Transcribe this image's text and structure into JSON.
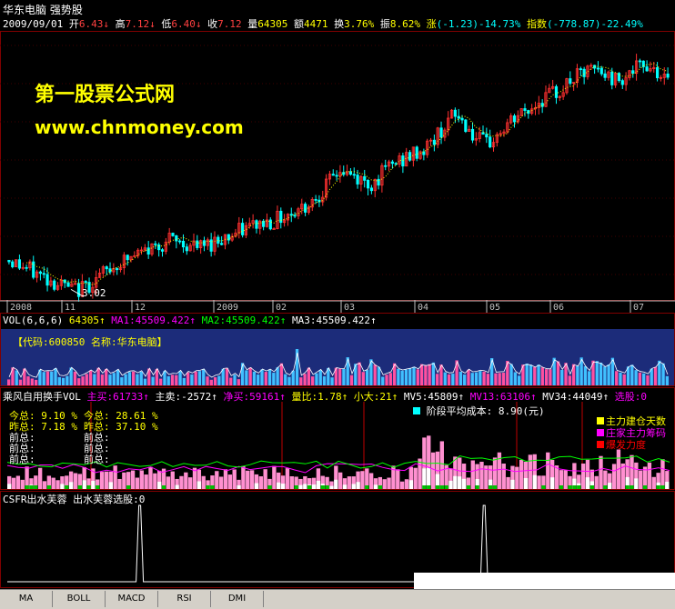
{
  "header": {
    "title": "华东电脑  强势股",
    "date": "2009/09/01",
    "open_label": "开",
    "open": "6.43",
    "high_label": "高",
    "high": "7.12",
    "low_label": "低",
    "low": "6.40",
    "close_label": "收",
    "close": "7.12",
    "vol_label": "量",
    "vol": "64305",
    "amount_label": "额",
    "amount": "4471",
    "turnover_label": "换",
    "turnover": "3.76%",
    "amplitude_label": "振",
    "amplitude": "8.62%",
    "change_label": "涨",
    "change": "(-1.23)-14.73%",
    "index_label": "指数",
    "index": "(-778.87)-22.49%",
    "arrow": "↓"
  },
  "watermark": {
    "line1": "第一股票公式网",
    "line2": "www.chnmoney.com"
  },
  "colors": {
    "up": "#ff3030",
    "down": "#00ffff",
    "ma_yellow": "#ffff00",
    "panel_border": "#800000",
    "vol_bg": "#1c2c7a",
    "vol_up_fill": "#ff50a0",
    "vol_down_fill": "#40c0ff"
  },
  "chart_data": [
    {
      "type": "candlestick",
      "x_axis_labels": [
        "2008",
        "11",
        "12",
        "2009",
        "02",
        "03",
        "04",
        "05",
        "06",
        "07"
      ],
      "annotation_low": "3.02",
      "note": "Price trend rises from about 3.0 to 7.5 over the period",
      "trend": [
        3.6,
        3.5,
        3.4,
        3.3,
        3.2,
        3.1,
        3.0,
        3.05,
        3.2,
        3.35,
        3.5,
        3.6,
        3.7,
        3.8,
        3.9,
        4.0,
        3.95,
        3.9,
        3.85,
        3.95,
        4.05,
        4.1,
        4.2,
        4.3,
        4.35,
        4.4,
        4.5,
        4.6,
        4.7,
        4.9,
        5.1,
        5.4,
        5.3,
        5.2,
        5.1,
        5.3,
        5.5,
        5.6,
        5.7,
        5.8,
        6.0,
        6.3,
        6.5,
        6.3,
        6.0,
        5.9,
        6.1,
        6.3,
        6.5,
        6.6,
        6.8,
        6.9,
        7.0,
        7.2,
        7.3,
        7.4,
        7.3,
        7.2,
        7.3,
        7.4,
        7.5,
        7.4,
        7.1
      ]
    },
    {
      "type": "bar",
      "title": "VOL(6,6,6)",
      "value": "64305",
      "ma1_label": "MA1:",
      "ma1": "45509.422",
      "ma2_label": "MA2:",
      "ma2": "45509.422",
      "ma3_label": "MA3:",
      "ma3": "45509.422",
      "info": "【代码:600850  名称:华东电脑】"
    },
    {
      "type": "bar",
      "title": "乘风自用换手VOL",
      "items": [
        {
          "label": "主买:",
          "value": "61733",
          "color": "#ff00ff"
        },
        {
          "label": "主卖:",
          "value": "-2572",
          "color": "#ffffff"
        },
        {
          "label": "净买:",
          "value": "59161",
          "color": "#ff00ff"
        },
        {
          "label": "量比:",
          "value": "1.78",
          "color": "#ffff00"
        },
        {
          "label": "小大:",
          "value": "21",
          "color": "#ffff00"
        },
        {
          "label": "MV5:",
          "value": "45809",
          "color": "#ffffff"
        },
        {
          "label": "MV13:",
          "value": "63106",
          "color": "#ff00ff"
        },
        {
          "label": "MV34:",
          "value": "44049",
          "color": "#ffffff"
        },
        {
          "label": "选股:",
          "value": "0",
          "color": "#ff00ff"
        }
      ],
      "stage_cost": "阶段平均成本: 8.90(元)",
      "legend": [
        {
          "text": "主力建仓天数",
          "color": "#ffff00"
        },
        {
          "text": "庄家主力筹码",
          "color": "#ff00ff"
        },
        {
          "text": "爆发力度",
          "color": "#ff0000"
        }
      ],
      "side_labels_left": [
        "今总: 9.10 %",
        "昨总: 7.18 %",
        "前总:",
        "前总:",
        "前总:"
      ],
      "side_labels_right": [
        "今总: 28.61 %",
        "昨总: 37.10 %",
        "前总:",
        "前总:",
        "前总:"
      ]
    },
    {
      "type": "line",
      "title": "CSFR出水芙蓉",
      "label2": "出水芙蓉选股:",
      "value": "0",
      "spikes": [
        0.2,
        0.72
      ]
    }
  ],
  "tabs": [
    "MA",
    "BOLL",
    "MACD",
    "RSI",
    "DMI"
  ]
}
